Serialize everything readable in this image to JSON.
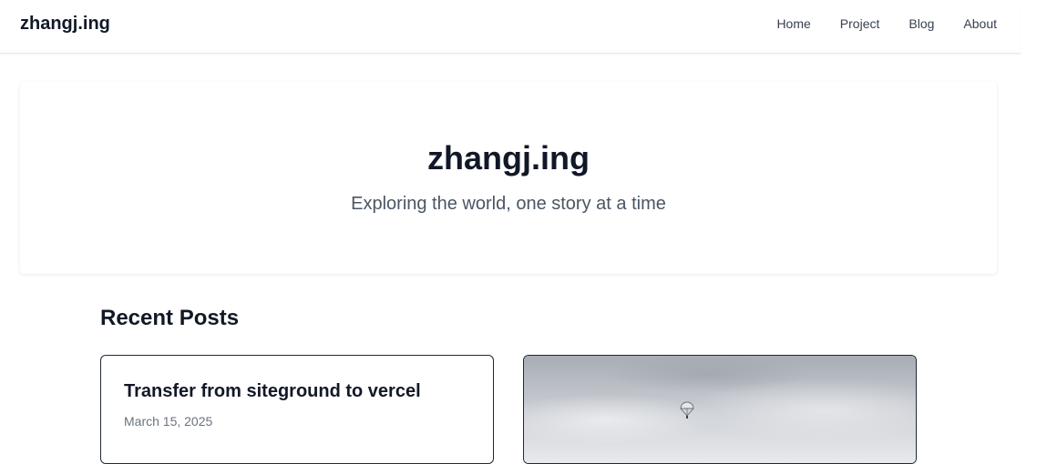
{
  "navbar": {
    "brand": "zhangj.ing",
    "links": [
      {
        "label": "Home"
      },
      {
        "label": "Project"
      },
      {
        "label": "Blog"
      },
      {
        "label": "About"
      }
    ]
  },
  "hero": {
    "title": "zhangj.ing",
    "subtitle": "Exploring the world, one story at a time"
  },
  "recent_posts": {
    "heading": "Recent Posts",
    "posts": [
      {
        "title": "Transfer from siteground to vercel",
        "date": "March 15, 2025"
      },
      {
        "image_icon": "parachute-sky-photo"
      }
    ]
  }
}
